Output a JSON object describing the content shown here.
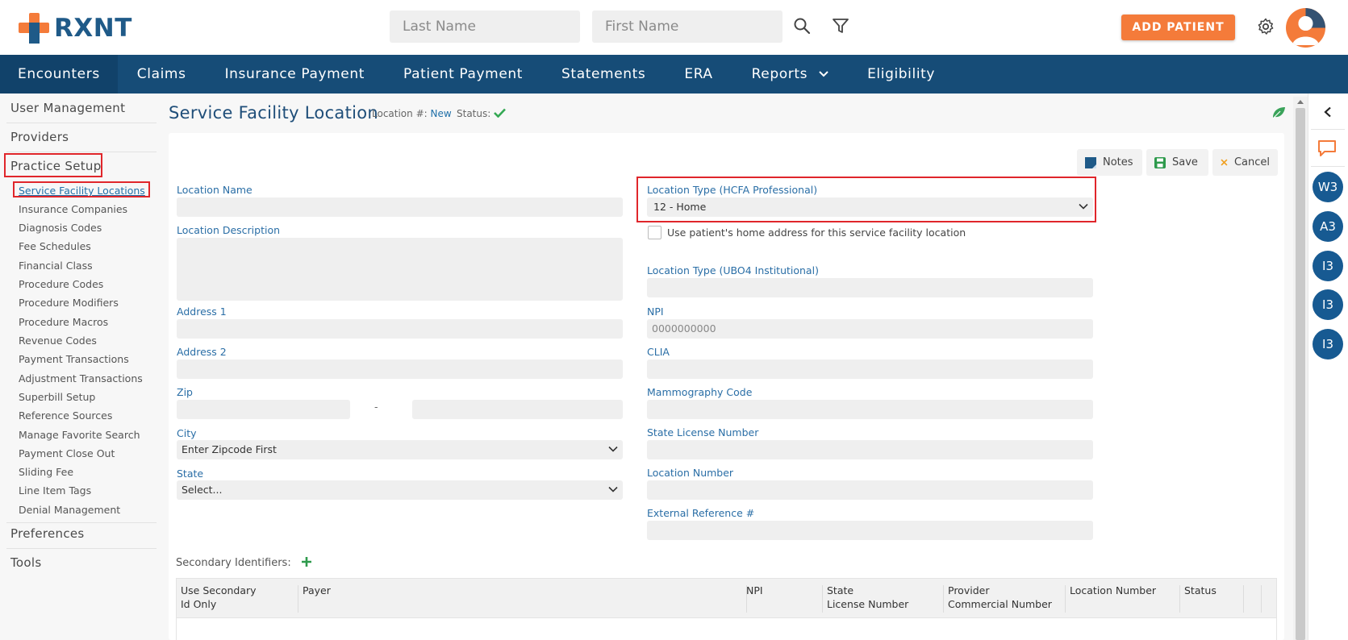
{
  "header": {
    "logo_text": "RXNT",
    "last_name_placeholder": "Last Name",
    "first_name_placeholder": "First Name",
    "add_patient_label": "ADD PATIENT",
    "icons": [
      "search-icon",
      "filter-icon",
      "gear-icon",
      "avatar"
    ]
  },
  "nav": {
    "items": [
      {
        "label": "Encounters"
      },
      {
        "label": "Claims"
      },
      {
        "label": "Insurance Payment"
      },
      {
        "label": "Patient Payment"
      },
      {
        "label": "Statements"
      },
      {
        "label": "ERA"
      },
      {
        "label": "Reports"
      },
      {
        "label": "Eligibility"
      }
    ]
  },
  "sidebar": {
    "user_management": "User Management",
    "providers": "Providers",
    "practice_setup": "Practice Setup",
    "sub_items": [
      "Service Facility Locations",
      "Insurance Companies",
      "Diagnosis Codes",
      "Fee Schedules",
      "Financial Class",
      "Procedure Codes",
      "Procedure Modifiers",
      "Procedure Macros",
      "Revenue Codes",
      "Payment Transactions",
      "Adjustment Transactions",
      "Superbill Setup",
      "Reference Sources",
      "Manage Favorite Search",
      "Payment Close Out",
      "Sliding Fee",
      "Line Item Tags",
      "Denial Management"
    ],
    "preferences": "Preferences",
    "tools": "Tools"
  },
  "page": {
    "title": "Service Facility Location",
    "location_label": "Location #:",
    "location_value": "New",
    "status_label": "Status:"
  },
  "toolbar": {
    "notes": "Notes",
    "save": "Save",
    "cancel": "Cancel"
  },
  "form": {
    "location_name_label": "Location Name",
    "location_description_label": "Location Description",
    "address1_label": "Address 1",
    "address2_label": "Address 2",
    "zip_label": "Zip",
    "zip_dash": "-",
    "city_label": "City",
    "city_value": "Enter Zipcode First",
    "state_label": "State",
    "state_value": "Select...",
    "location_type_hcfa_label": "Location Type (HCFA Professional)",
    "location_type_hcfa_value": "12 - Home",
    "use_home_address_label": "Use patient's home address for this service facility location",
    "location_type_ubo4_label": "Location Type (UBO4 Institutional)",
    "npi_label": "NPI",
    "npi_placeholder": "0000000000",
    "clia_label": "CLIA",
    "mammography_label": "Mammography Code",
    "state_license_label": "State License Number",
    "location_number_label": "Location Number",
    "external_ref_label": "External Reference #"
  },
  "secondary": {
    "label": "Secondary Identifiers:",
    "columns": [
      {
        "line1": "Use Secondary",
        "line2": "Id Only"
      },
      {
        "line1": "Payer",
        "line2": ""
      },
      {
        "line1": "NPI",
        "line2": ""
      },
      {
        "line1": "State",
        "line2": "License Number"
      },
      {
        "line1": "Provider",
        "line2": "Commercial Number"
      },
      {
        "line1": "Location Number",
        "line2": ""
      },
      {
        "line1": "Status",
        "line2": ""
      }
    ]
  },
  "rail": {
    "circles": [
      "W3",
      "A3",
      "I3",
      "I3",
      "I3"
    ]
  },
  "colors": {
    "brand_orange": "#f47b3a",
    "nav_blue": "#164c77",
    "label_blue": "#2a6ea6",
    "highlight_red": "#e0262b"
  }
}
